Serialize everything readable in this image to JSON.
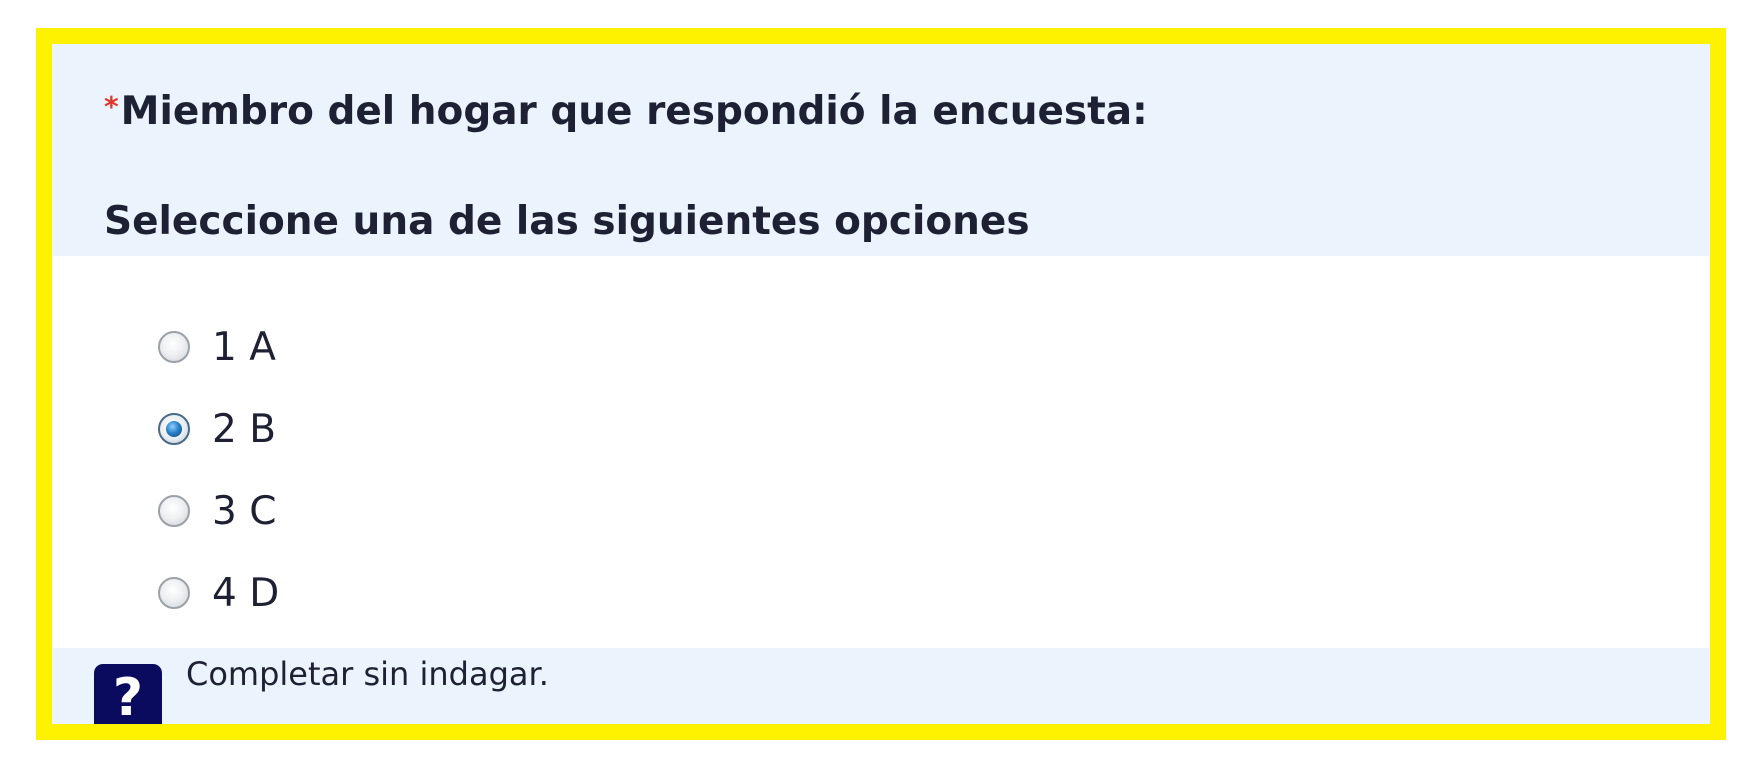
{
  "question": {
    "required_mark": "*",
    "title": "Miembro del hogar que respondió la encuesta:",
    "instruction": "Seleccione una de las siguientes opciones"
  },
  "options": [
    {
      "label": "1 A",
      "selected": false
    },
    {
      "label": "2 B",
      "selected": true
    },
    {
      "label": "3 C",
      "selected": false
    },
    {
      "label": "4 D",
      "selected": false
    }
  ],
  "help": {
    "icon": "question-mark-icon",
    "text": "Completar sin indagar."
  },
  "colors": {
    "highlight_border": "#fff200",
    "header_background": "#ebf4fd",
    "required_mark": "#e0392b",
    "help_icon_background": "#0a0a5e"
  }
}
